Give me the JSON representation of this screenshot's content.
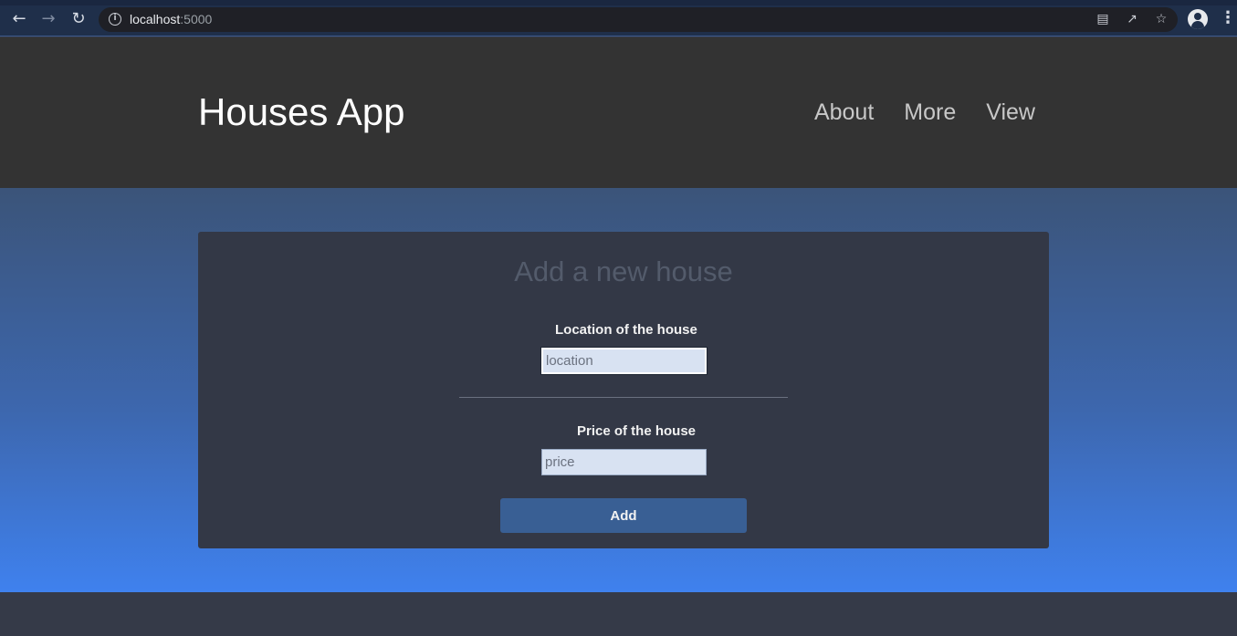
{
  "browser": {
    "url_host": "localhost",
    "url_port": ":5000",
    "icons": [
      "back-arrow-icon",
      "forward-arrow-icon",
      "reload-icon",
      "info-icon",
      "translate-icon",
      "share-icon",
      "star-icon",
      "profile-icon",
      "kebab-menu-icon"
    ]
  },
  "header": {
    "brand": "Houses App",
    "nav": [
      "About",
      "More",
      "View"
    ]
  },
  "form": {
    "title": "Add a new house",
    "location_label": "Location of the house",
    "location_placeholder": "location",
    "location_value": "",
    "price_label": "Price of the house",
    "price_placeholder": "price",
    "price_value": "",
    "submit_label": "Add"
  },
  "colors": {
    "header_bg": "#333333",
    "card_bg": "#333846",
    "gradient_top": "#3b5479",
    "gradient_bottom": "#3f81ee",
    "button_bg": "#395f94"
  }
}
